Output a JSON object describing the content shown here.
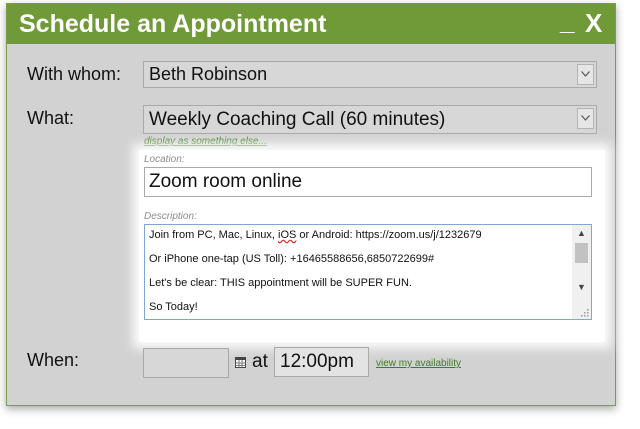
{
  "dialog": {
    "title": "Schedule an Appointment",
    "minimize_label": "_",
    "close_label": "X"
  },
  "with_whom": {
    "label": "With whom:",
    "selected": "Beth Robinson"
  },
  "what": {
    "label": "What:",
    "selected": "Weekly Coaching Call (60 minutes)",
    "alt_link": "display as something else..."
  },
  "location": {
    "caption": "Location:",
    "value": "Zoom room online"
  },
  "description": {
    "caption": "Description:",
    "line1_pre": "Join from PC, Mac, Linux, ",
    "line1_ios": "iOS",
    "line1_post": " or Android: https://zoom.us/j/1232679",
    "line2": "Or iPhone one-tap (US Toll):  +16465588656,6850722699#",
    "line3": "Let's be clear: THIS appointment will be SUPER FUN.",
    "line4": "So Today!"
  },
  "when": {
    "label": "When:",
    "date_value": "",
    "at_label": "at",
    "time_value": "12:00pm",
    "availability_link": "view my availability"
  },
  "colors": {
    "title_bar": "#6f9a37",
    "dialog_bg": "#d2d2d2",
    "link": "#3f7d22"
  },
  "icons": [
    "chevron-down-icon",
    "calendar-icon",
    "scroll-up-icon",
    "scroll-down-icon",
    "resize-grip-icon"
  ]
}
